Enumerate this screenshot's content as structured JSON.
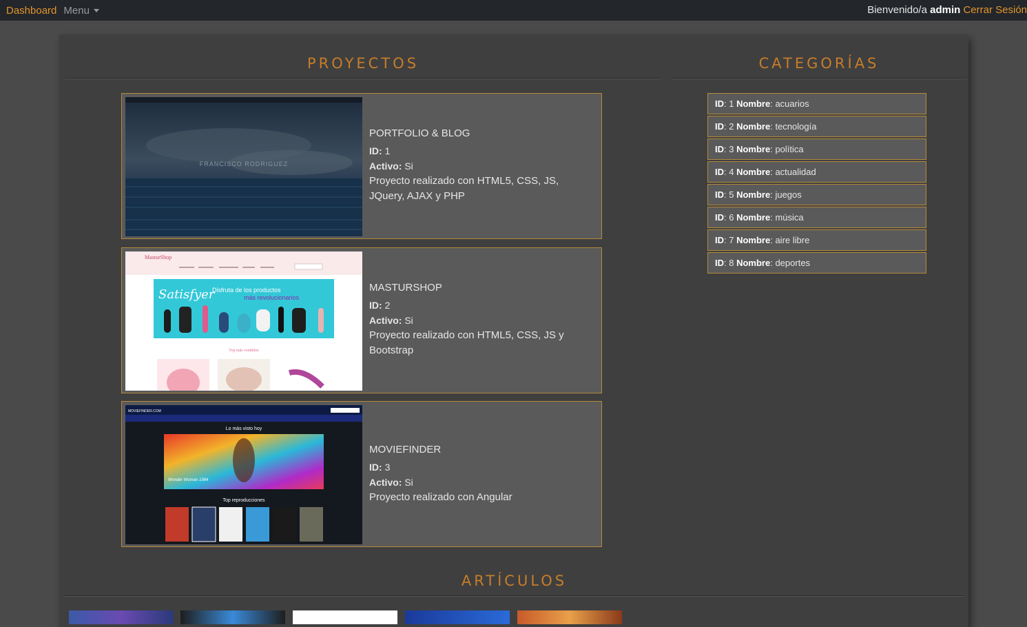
{
  "navbar": {
    "brand": "Dashboard",
    "menu": "Menu",
    "welcome": "Bienvenido/a ",
    "user": "admin",
    "logout": " Cerrar Sesión"
  },
  "projects_section": {
    "title": "PROYECTOS",
    "items": [
      {
        "name": "PORTFOLIO & BLOG",
        "id_label": "ID:",
        "id": "1",
        "active_label": "Activo:",
        "active": "Si",
        "description": "Proyecto realizado con HTML5, CSS, JS, JQuery, AJAX y PHP"
      },
      {
        "name": "MASTURSHOP",
        "id_label": "ID:",
        "id": "2",
        "active_label": "Activo:",
        "active": "Si",
        "description": "Proyecto realizado con HTML5, CSS, JS y Bootstrap"
      },
      {
        "name": "MOVIEFINDER",
        "id_label": "ID:",
        "id": "3",
        "active_label": "Activo:",
        "active": "Si",
        "description": "Proyecto realizado con Angular"
      }
    ]
  },
  "categories_section": {
    "title": "CATEGORÍAS",
    "id_label": "ID",
    "name_label": "Nombre",
    "items": [
      {
        "id": "1",
        "name": "acuarios"
      },
      {
        "id": "2",
        "name": "tecnología"
      },
      {
        "id": "3",
        "name": "política"
      },
      {
        "id": "4",
        "name": "actualidad"
      },
      {
        "id": "5",
        "name": "juegos"
      },
      {
        "id": "6",
        "name": "música"
      },
      {
        "id": "7",
        "name": "aire libre"
      },
      {
        "id": "8",
        "name": "deportes"
      }
    ]
  },
  "articles_section": {
    "title": "ARTÍCULOS"
  },
  "thumbnails": {
    "portfolio_text": "FRANCISCO RODRIGUEZ",
    "masturshop_logo": "MasturShop",
    "masturshop_banner": "Disfruta de los productos",
    "masturshop_banner2": "más revolucionarios",
    "masturshop_brand": "Satisfyer",
    "masturshop_top": "Top más vendidos",
    "moviefinder_logo": "MOVIEFINDER.COM",
    "moviefinder_heading": "Lo más visto hoy",
    "moviefinder_caption": "Wonder Woman 1984",
    "moviefinder_top": "Top reproducciones"
  },
  "colors": {
    "accent": "#e3952b",
    "card_border": "#b58a3c",
    "card_bg": "#5a5a5a",
    "panel_bg": "#3f3f3f",
    "navbar_bg": "#23262b"
  }
}
